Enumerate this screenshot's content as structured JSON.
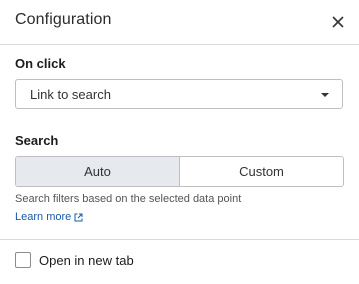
{
  "dialog": {
    "title": "Configuration",
    "close_icon": "close-icon"
  },
  "on_click": {
    "label": "On click",
    "selected_value": "Link to search",
    "dropdown_icon": "chevron-down-icon"
  },
  "search": {
    "label": "Search",
    "modes": [
      "Auto",
      "Custom"
    ],
    "active_mode": "Auto",
    "help_text": "Search filters based on the selected data point",
    "learn_more": "Learn more",
    "external_link_icon": "external-link-icon"
  },
  "options": {
    "open_new_tab_label": "Open in new tab",
    "open_new_tab_checked": false
  }
}
